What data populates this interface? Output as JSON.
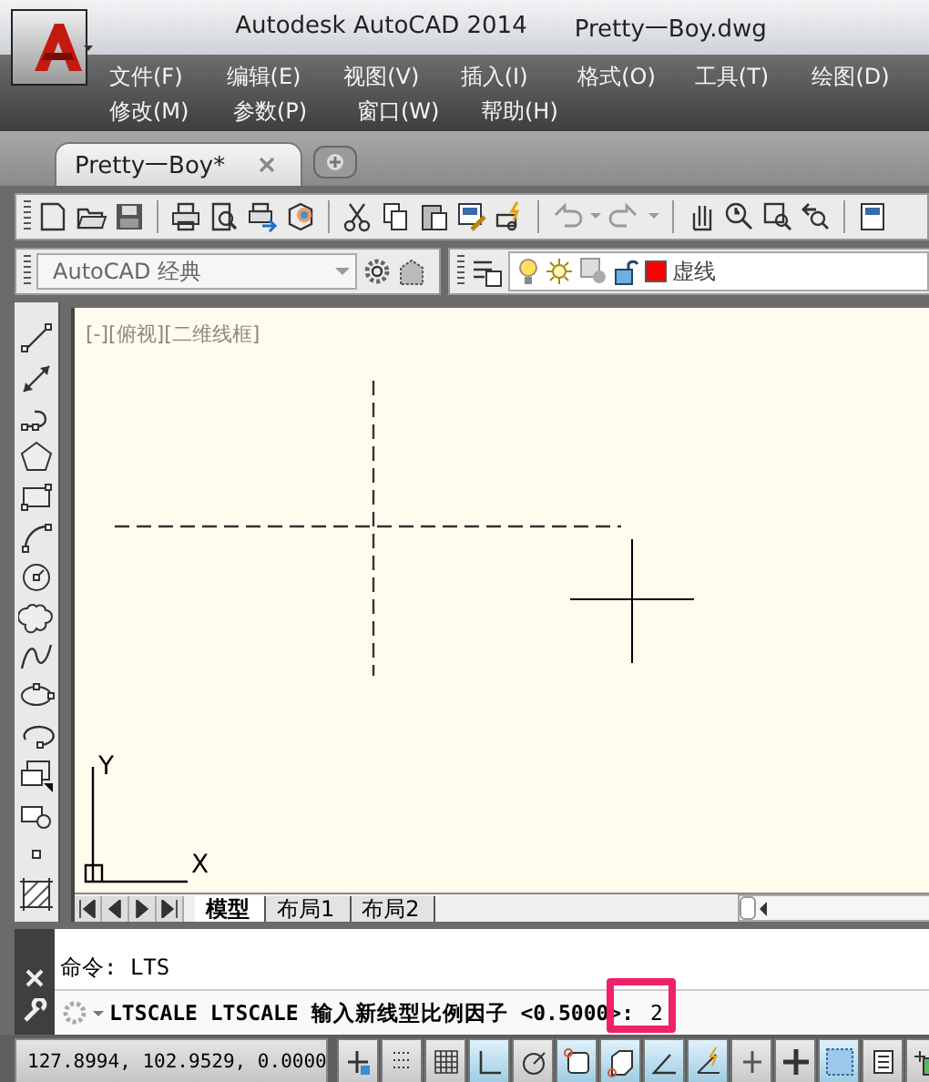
{
  "window": {
    "app_title": "Autodesk AutoCAD 2014",
    "file_title": "Pretty一Boy.dwg"
  },
  "menu_rows": [
    [
      "文件(F)",
      "编辑(E)",
      "视图(V)",
      "插入(I)",
      "格式(O)",
      "工具(T)",
      "绘图(D)"
    ],
    [
      "修改(M)",
      "参数(P)",
      "窗口(W)",
      "帮助(H)"
    ]
  ],
  "document_tabs": [
    {
      "label": "Pretty一Boy*",
      "selected": true
    }
  ],
  "workspace": {
    "value": "AutoCAD 经典"
  },
  "layer": {
    "name": "虚线",
    "color": "#ff0000"
  },
  "viewport_label": "[-][俯视][二维线框]",
  "ucs": {
    "x_label": "X",
    "y_label": "Y"
  },
  "layout_tabs": [
    {
      "label": "模型",
      "selected": true
    },
    {
      "label": "布局1",
      "selected": false
    },
    {
      "label": "布局2",
      "selected": false
    }
  ],
  "command": {
    "history": "命令: LTS",
    "prompt": "LTSCALE LTSCALE 输入新线型比例因子 <0.5000>:",
    "value": "2"
  },
  "status": {
    "coordinates": "127.8994, 102.9529, 0.0000",
    "toggles": [
      {
        "kind": "infer",
        "on": false
      },
      {
        "kind": "snap",
        "on": false
      },
      {
        "kind": "grid",
        "on": false
      },
      {
        "kind": "ortho",
        "on": true
      },
      {
        "kind": "polar",
        "on": false
      },
      {
        "kind": "osnap",
        "on": true
      },
      {
        "kind": "osnap3d",
        "on": true
      },
      {
        "kind": "otrack",
        "on": true
      },
      {
        "kind": "ducs",
        "on": true
      },
      {
        "kind": "dyn",
        "on": false
      },
      {
        "kind": "lineweight",
        "on": false
      },
      {
        "kind": "transparency",
        "on": true
      },
      {
        "kind": "quickprops",
        "on": false
      },
      {
        "kind": "cycling",
        "on": false
      }
    ]
  }
}
